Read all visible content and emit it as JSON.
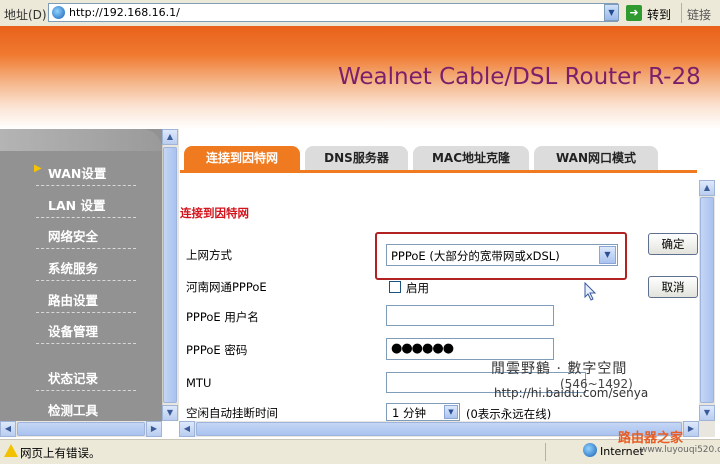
{
  "address_bar": {
    "label": "地址(D)",
    "url": "http://192.168.16.1/",
    "go_label": "转到",
    "links_label": "链接"
  },
  "banner": {
    "title": "Wealnet Cable/DSL Router R-28"
  },
  "sidebar": {
    "items": [
      {
        "label": "WAN设置",
        "active": true
      },
      {
        "label": "LAN 设置"
      },
      {
        "label": "网络安全"
      },
      {
        "label": "系统服务"
      },
      {
        "label": "路由设置"
      },
      {
        "label": "设备管理"
      },
      {
        "label": "状态记录"
      },
      {
        "label": "检测工具"
      }
    ]
  },
  "tabs": [
    {
      "label": "连接到因特网",
      "active": true
    },
    {
      "label": "DNS服务器"
    },
    {
      "label": "MAC地址克隆"
    },
    {
      "label": "WAN网口模式"
    }
  ],
  "form": {
    "section_title": "连接到因特网",
    "connection_type_label": "上网方式",
    "connection_type_value": "PPPoE (大部分的宽带网或xDSL)",
    "henan_label": "河南网通PPPoE",
    "henan_checkbox_label": "启用",
    "username_label": "PPPoE 用户名",
    "username_value": "",
    "password_label": "PPPoE 密码",
    "password_value": "●●●●●●",
    "mtu_label": "MTU",
    "mtu_value": "",
    "idle_label": "空闲自动挂断时间",
    "idle_value": "1 分钟",
    "idle_hint": "(0表示永远在线)"
  },
  "buttons": {
    "ok": "确定",
    "cancel": "取消"
  },
  "watermark": {
    "title": "閒雲野鶴 · 數字空間",
    "number": "(546~1492)",
    "url": "http://hi.baidu.com/senya"
  },
  "status_bar": {
    "message": "网页上有错误。",
    "zone": "Internet",
    "footer_brand": "路由器之家",
    "footer_url": "www.luyouqi520.com"
  },
  "colors": {
    "accent_orange": "#f07a20",
    "banner_title": "#7a1f6b",
    "section_red": "#d4141c",
    "highlight_frame": "#b22222"
  }
}
